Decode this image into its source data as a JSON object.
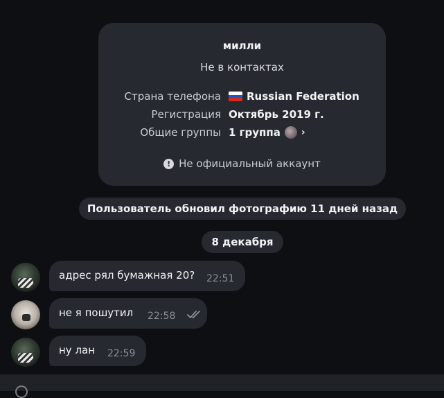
{
  "profile_card": {
    "name": "милли",
    "status": "Не в контактах",
    "rows": [
      {
        "label": "Страна телефона",
        "value": "Russian Federation",
        "icon": "russia-flag-icon"
      },
      {
        "label": "Регистрация",
        "value": "Октябрь 2019 г."
      },
      {
        "label": "Общие группы",
        "value": "1 группа",
        "icon": "group-avatar"
      }
    ],
    "unofficial": "Не официальный аккаунт"
  },
  "service": {
    "photo_update": "Пользователь обновил фотографию 11 дней назад",
    "date": "8 декабря"
  },
  "messages": [
    {
      "text": "адрес рял бумажная 20?",
      "time": "22:51",
      "outgoing": false
    },
    {
      "text": "не я пошутил",
      "time": "22:58",
      "outgoing": true,
      "read": true
    },
    {
      "text": "ну лан",
      "time": "22:59",
      "outgoing": false
    }
  ],
  "colors": {
    "background": "#0e0f12",
    "bubble": "#26292f",
    "time": "#8b8f97"
  }
}
